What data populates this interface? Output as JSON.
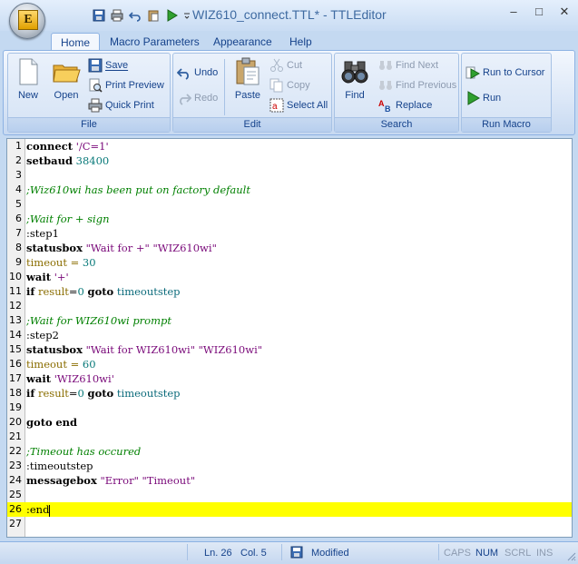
{
  "window": {
    "title": "WIZ610_connect.TTL* - TTLEditor",
    "app_letter": "E"
  },
  "tabs": [
    "Home",
    "Macro Parameters",
    "Appearance",
    "Help"
  ],
  "ribbon": {
    "file": {
      "title": "File",
      "new": "New",
      "open": "Open",
      "save": "Save",
      "print_preview": "Print Preview",
      "quick_print": "Quick Print"
    },
    "edit": {
      "title": "Edit",
      "undo": "Undo",
      "redo": "Redo",
      "paste": "Paste",
      "cut": "Cut",
      "copy": "Copy",
      "select_all": "Select All"
    },
    "search": {
      "title": "Search",
      "find": "Find",
      "find_next": "Find Next",
      "find_previous": "Find Previous",
      "replace": "Replace"
    },
    "run_macro": {
      "title": "Run Macro",
      "run_to_cursor": "Run to Cursor",
      "run": "Run"
    }
  },
  "editor": {
    "current_line": 26,
    "lines": [
      {
        "n": "1",
        "tokens": [
          [
            "kw",
            "connect"
          ],
          [
            "op",
            " "
          ],
          [
            "str",
            "'/C=1'"
          ]
        ]
      },
      {
        "n": "2",
        "tokens": [
          [
            "kw",
            "setbaud"
          ],
          [
            "op",
            " "
          ],
          [
            "num-t",
            "38400"
          ]
        ]
      },
      {
        "n": "3",
        "tokens": []
      },
      {
        "n": "4",
        "tokens": [
          [
            "cm",
            ";Wiz610wi has been put on factory default"
          ]
        ]
      },
      {
        "n": "5",
        "tokens": []
      },
      {
        "n": "6",
        "tokens": [
          [
            "cm",
            ";Wait for + sign"
          ]
        ]
      },
      {
        "n": "7",
        "tokens": [
          [
            "lbl",
            ":step1"
          ]
        ]
      },
      {
        "n": "8",
        "tokens": [
          [
            "kw",
            "statusbox"
          ],
          [
            "op",
            " "
          ],
          [
            "str",
            "\"Wait for +\""
          ],
          [
            "op",
            " "
          ],
          [
            "str",
            "\"WIZ610wi\""
          ]
        ]
      },
      {
        "n": "9",
        "tokens": [
          [
            "var",
            "timeout"
          ],
          [
            "op",
            " "
          ],
          [
            "var",
            "="
          ],
          [
            "op",
            " "
          ],
          [
            "num-t",
            "30"
          ]
        ]
      },
      {
        "n": "10",
        "tokens": [
          [
            "kw",
            "wait"
          ],
          [
            "op",
            " "
          ],
          [
            "str",
            "'+'"
          ]
        ]
      },
      {
        "n": "11",
        "tokens": [
          [
            "kw",
            "if"
          ],
          [
            "op",
            " "
          ],
          [
            "var",
            "result"
          ],
          [
            "op",
            "="
          ],
          [
            "num-t",
            "0"
          ],
          [
            "op",
            " "
          ],
          [
            "kw",
            "goto"
          ],
          [
            "op",
            " "
          ],
          [
            "ident",
            "timeoutstep"
          ]
        ]
      },
      {
        "n": "12",
        "tokens": []
      },
      {
        "n": "13",
        "tokens": [
          [
            "cm",
            ";Wait for WIZ610wi prompt"
          ]
        ]
      },
      {
        "n": "14",
        "tokens": [
          [
            "lbl",
            ":step2"
          ]
        ]
      },
      {
        "n": "15",
        "tokens": [
          [
            "kw",
            "statusbox"
          ],
          [
            "op",
            " "
          ],
          [
            "str",
            "\"Wait for WIZ610wi\""
          ],
          [
            "op",
            " "
          ],
          [
            "str",
            "\"WIZ610wi\""
          ]
        ]
      },
      {
        "n": "16",
        "tokens": [
          [
            "var",
            "timeout"
          ],
          [
            "op",
            " "
          ],
          [
            "var",
            "="
          ],
          [
            "op",
            " "
          ],
          [
            "num-t",
            "60"
          ]
        ]
      },
      {
        "n": "17",
        "tokens": [
          [
            "kw",
            "wait"
          ],
          [
            "op",
            " "
          ],
          [
            "str",
            "'WIZ610wi'"
          ]
        ]
      },
      {
        "n": "18",
        "tokens": [
          [
            "kw",
            "if"
          ],
          [
            "op",
            " "
          ],
          [
            "var",
            "result"
          ],
          [
            "op",
            "="
          ],
          [
            "num-t",
            "0"
          ],
          [
            "op",
            " "
          ],
          [
            "kw",
            "goto"
          ],
          [
            "op",
            " "
          ],
          [
            "ident",
            "timeoutstep"
          ]
        ]
      },
      {
        "n": "19",
        "tokens": []
      },
      {
        "n": "20",
        "tokens": [
          [
            "kw",
            "goto"
          ],
          [
            "op",
            " "
          ],
          [
            "kw",
            "end"
          ]
        ]
      },
      {
        "n": "21",
        "tokens": []
      },
      {
        "n": "22",
        "tokens": [
          [
            "cm",
            ";Timeout has occured"
          ]
        ]
      },
      {
        "n": "23",
        "tokens": [
          [
            "lbl",
            ":timeoutstep"
          ]
        ]
      },
      {
        "n": "24",
        "tokens": [
          [
            "kw",
            "messagebox"
          ],
          [
            "op",
            " "
          ],
          [
            "str",
            "\"Error\""
          ],
          [
            "op",
            " "
          ],
          [
            "str",
            "\"Timeout\""
          ]
        ]
      },
      {
        "n": "25",
        "tokens": []
      },
      {
        "n": "26",
        "tokens": [
          [
            "lbl",
            ":end"
          ]
        ]
      },
      {
        "n": "27",
        "tokens": []
      }
    ]
  },
  "status": {
    "line": "Ln. 26",
    "col": "Col. 5",
    "modified": "Modified",
    "caps": "CAPS",
    "num": "NUM",
    "scrl": "SCRL",
    "ins": "INS"
  },
  "colors": {
    "current_line_highlight": "#ffff00",
    "ribbon_text": "#15428b",
    "frame": "#c4d9f1"
  }
}
